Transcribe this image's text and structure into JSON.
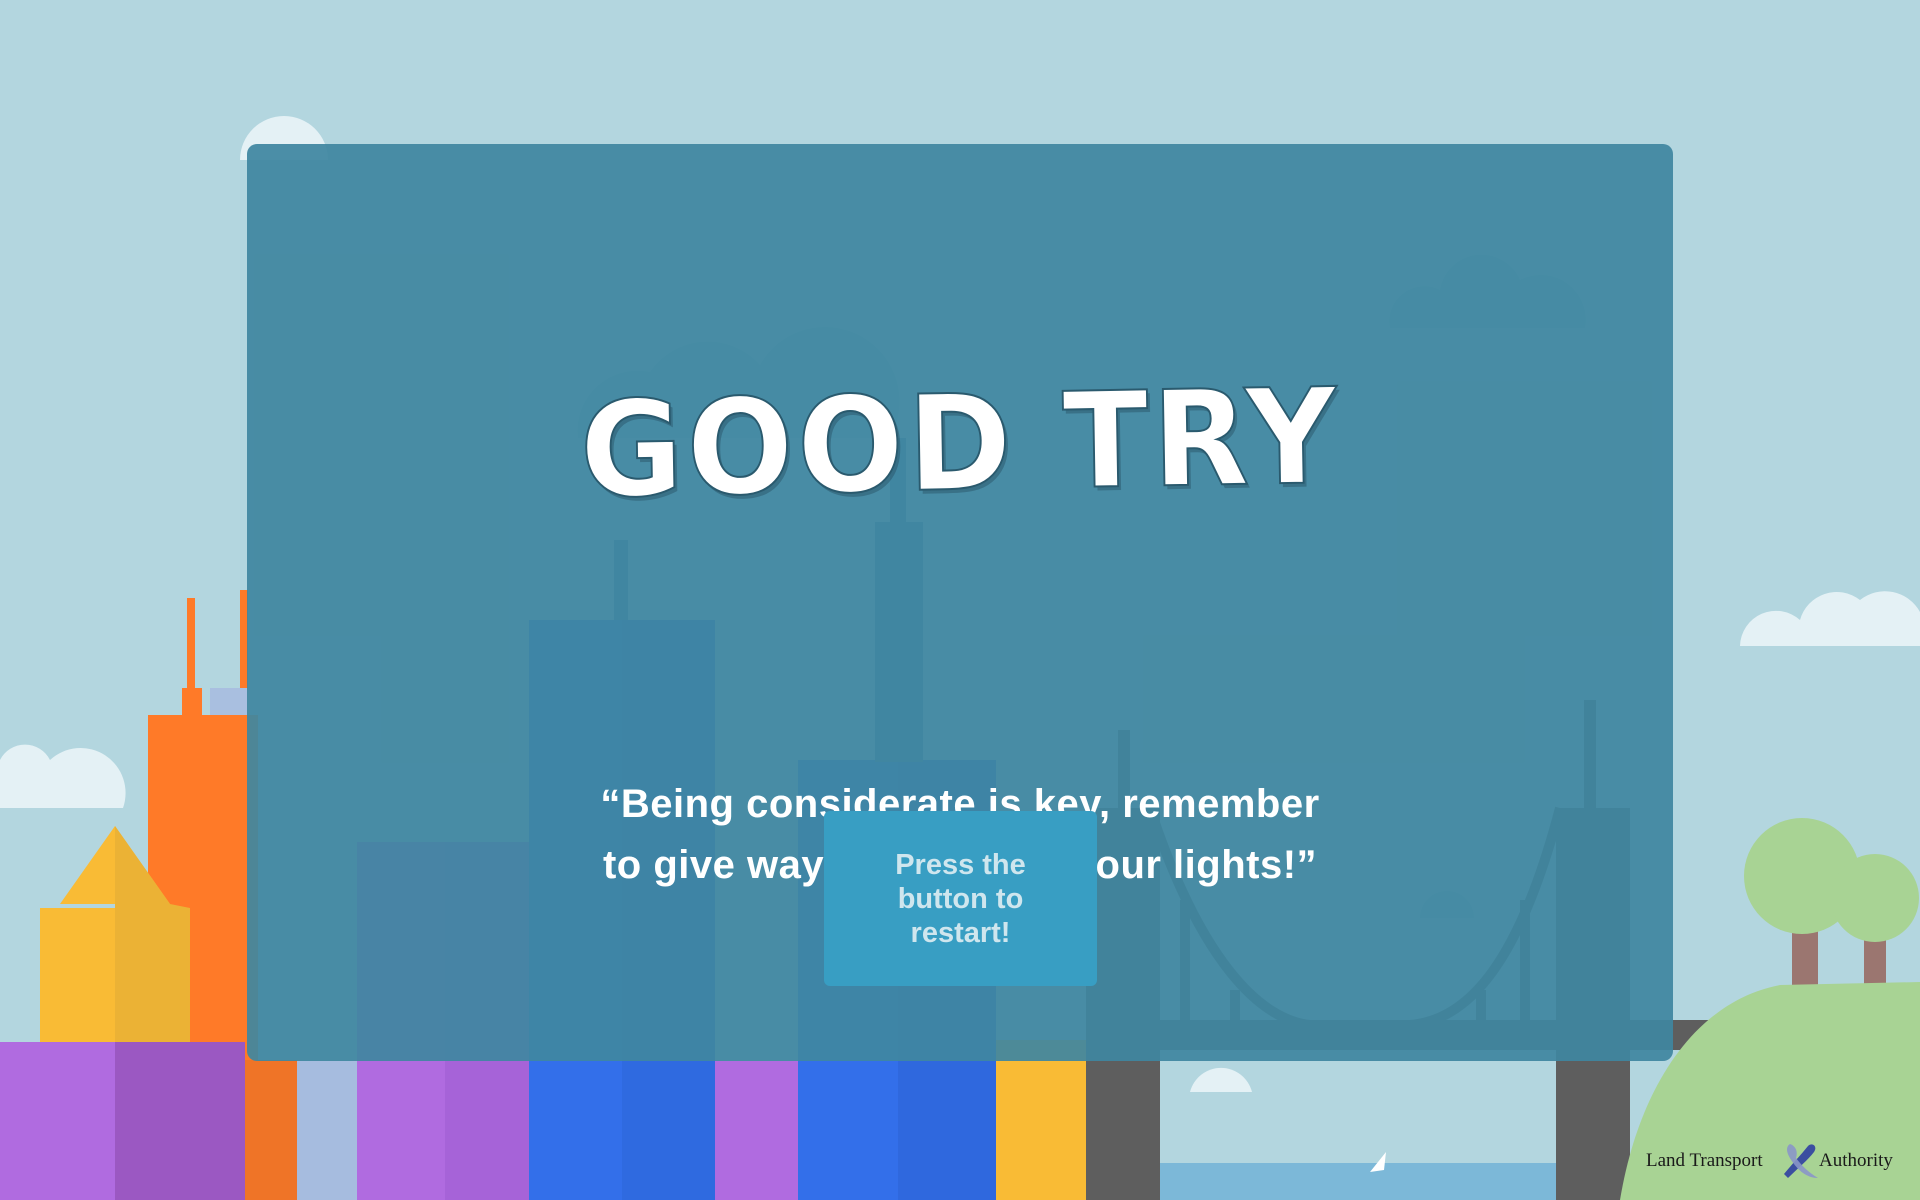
{
  "result": {
    "title": "GOOD TRY",
    "quote_line1": "“Being considerate is key, remember",
    "quote_line2": "to give way and turn on your lights!”"
  },
  "restart_button": {
    "line1": "Press the",
    "line2": "button to",
    "line3": "restart!"
  },
  "logo": {
    "left_text": "Land Transport",
    "right_text": "Authority"
  },
  "colors": {
    "sky": "#b3d6df",
    "panel": "#4086a0",
    "button": "#389ec3",
    "hill": "#a8d394",
    "orange_building": "#ff7a28",
    "purple_building": "#b06be0",
    "blue_building": "#336fea",
    "yellow_building": "#f9bb35",
    "bridge": "#5e5e5e"
  }
}
